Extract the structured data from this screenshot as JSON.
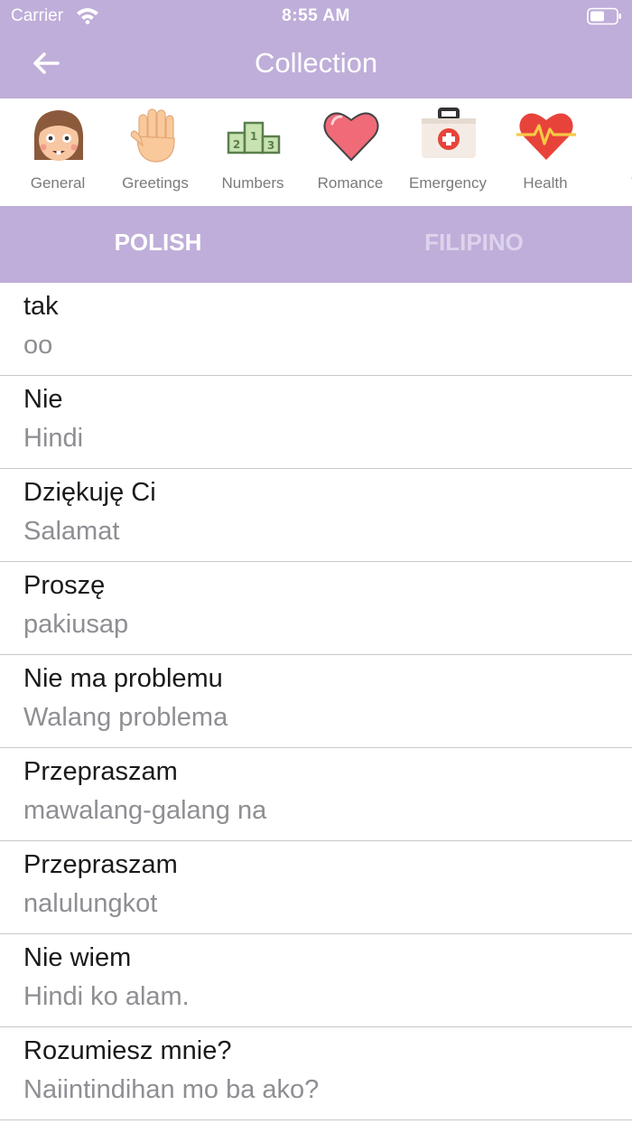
{
  "status_bar": {
    "carrier": "Carrier",
    "time": "8:55 AM"
  },
  "nav": {
    "title": "Collection"
  },
  "categories": [
    {
      "label": "General",
      "icon": "girl-face-icon"
    },
    {
      "label": "Greetings",
      "icon": "waving-hand-icon"
    },
    {
      "label": "Numbers",
      "icon": "podium-numbers-icon"
    },
    {
      "label": "Romance",
      "icon": "heart-icon"
    },
    {
      "label": "Emergency",
      "icon": "first-aid-kit-icon"
    },
    {
      "label": "Health",
      "icon": "heartbeat-icon"
    },
    {
      "label": "We",
      "icon": "weather-icon"
    }
  ],
  "tabs": {
    "source": "POLISH",
    "target": "FILIPINO"
  },
  "colors": {
    "accent": "#bfaed9",
    "divider": "#c9c9c9",
    "secondary_text": "#8e8e93"
  },
  "phrases": [
    {
      "source": "tak",
      "target": "oo"
    },
    {
      "source": "Nie",
      "target": "Hindi"
    },
    {
      "source": "Dziękuję Ci",
      "target": "Salamat"
    },
    {
      "source": "Proszę",
      "target": "pakiusap"
    },
    {
      "source": "Nie ma problemu",
      "target": "Walang problema"
    },
    {
      "source": "Przepraszam",
      "target": "mawalang-galang na"
    },
    {
      "source": "Przepraszam",
      "target": "nalulungkot"
    },
    {
      "source": "Nie wiem",
      "target": "Hindi ko alam."
    },
    {
      "source": "Rozumiesz mnie?",
      "target": "Naiintindihan mo ba ako?"
    }
  ]
}
